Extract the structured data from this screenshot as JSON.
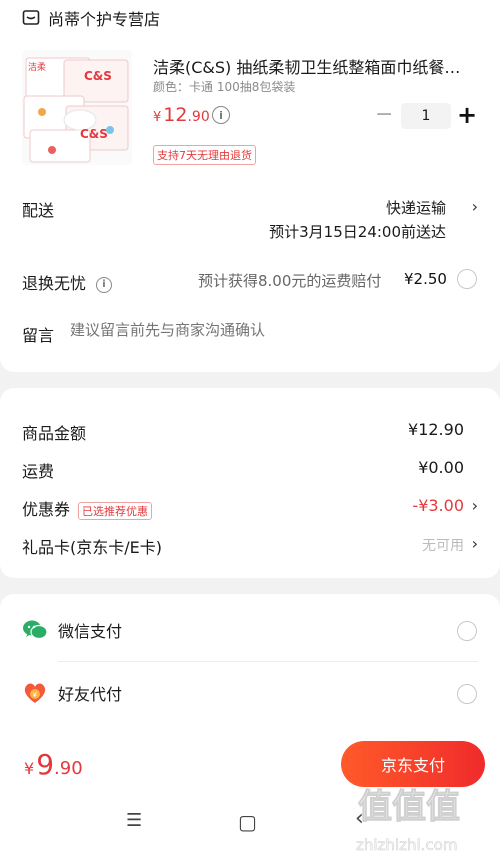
{
  "store": {
    "name": "尚蒂个护专营店",
    "icon": "store-icon"
  },
  "product": {
    "title": "洁柔(C&S) 抽纸柔韧卫生纸整箱面巾纸餐…",
    "spec": "颜色：卡通 100抽8包袋装",
    "price_currency": "¥",
    "price_int": "12",
    "price_dec": ".90",
    "quantity": "1",
    "minus": "−",
    "plus": "+",
    "return_policy": "支持7天无理由退货",
    "thumb_brand": "洁柔",
    "thumb_logo": "C&S"
  },
  "delivery": {
    "label": "配送",
    "method": "快递运输",
    "eta": "预计3月15日24:00前送达"
  },
  "returns": {
    "label": "退换无忧",
    "info": "i",
    "desc": "预计获得8.00元的运费赔付",
    "price": "¥2.50"
  },
  "message": {
    "label": "留言",
    "placeholder": "建议留言前先与商家沟通确认"
  },
  "summary": {
    "goods_label": "商品金额",
    "goods_value": "¥12.90",
    "shipping_label": "运费",
    "shipping_value": "¥0.00",
    "coupon_label": "优惠券",
    "coupon_tag": "已选推荐优惠",
    "coupon_value": "-¥3.00",
    "giftcard_label": "礼品卡(京东卡/E卡)",
    "giftcard_value": "无可用"
  },
  "payment": {
    "wechat": "微信支付",
    "friend": "好友代付"
  },
  "footer": {
    "total_currency": "¥",
    "total_int": "9",
    "total_dec": ".90",
    "pay_button": "京东支付"
  },
  "nav": {
    "menu": "☰",
    "home": "▢",
    "back": "‹"
  },
  "watermark": {
    "text": "值 值 值",
    "url": "zhizhizhi.com"
  },
  "colors": {
    "accent": "#e4393c",
    "wechat": "#2aae67",
    "pay_btn": "#f23030"
  }
}
